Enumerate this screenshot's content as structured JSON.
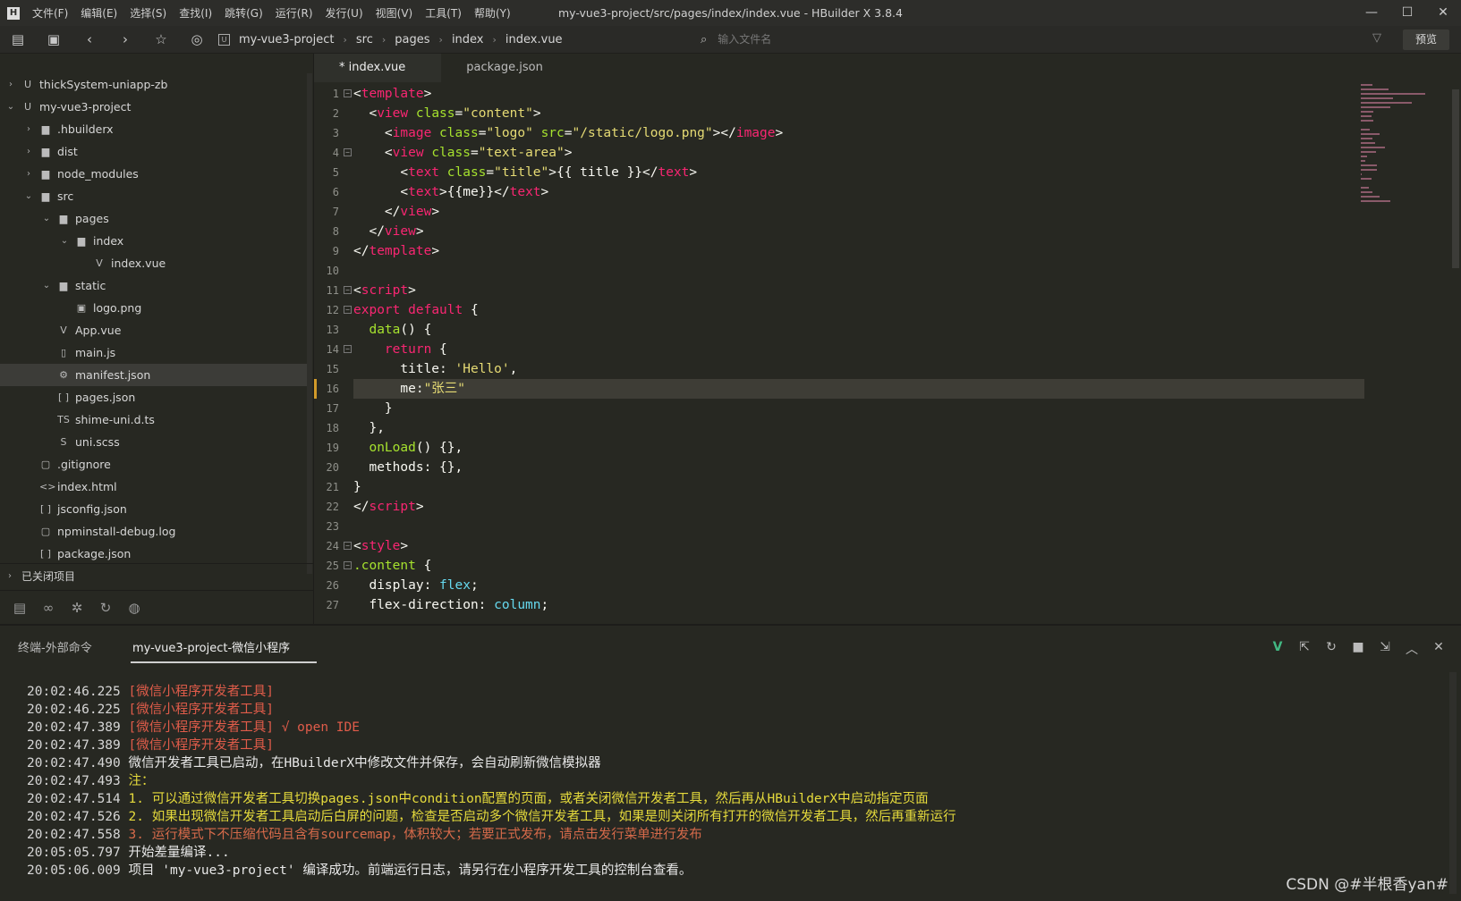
{
  "app": {
    "logo": "H",
    "title": "my-vue3-project/src/pages/index/index.vue - HBuilder X 3.8.4",
    "menu": [
      "文件(F)",
      "编辑(E)",
      "选择(S)",
      "查找(I)",
      "跳转(G)",
      "运行(R)",
      "发行(U)",
      "视图(V)",
      "工具(T)",
      "帮助(Y)"
    ],
    "window_buttons": {
      "minimize": "—",
      "maximize": "☐",
      "close": "✕"
    }
  },
  "toolbar": {
    "project_badge": "U",
    "breadcrumb": [
      "my-vue3-project",
      "src",
      "pages",
      "index",
      "index.vue"
    ],
    "search_placeholder": "输入文件名",
    "preview_label": "预览"
  },
  "sidebar": {
    "tree": [
      {
        "label": "thickSystem-uniapp-zb",
        "depth": 0,
        "arrow": "›",
        "icon": "U"
      },
      {
        "label": "my-vue3-project",
        "depth": 0,
        "arrow": "⌄",
        "icon": "U"
      },
      {
        "label": ".hbuilderx",
        "depth": 1,
        "arrow": "›",
        "icon": "▆"
      },
      {
        "label": "dist",
        "depth": 1,
        "arrow": "›",
        "icon": "▆"
      },
      {
        "label": "node_modules",
        "depth": 1,
        "arrow": "›",
        "icon": "▆"
      },
      {
        "label": "src",
        "depth": 1,
        "arrow": "⌄",
        "icon": "▆"
      },
      {
        "label": "pages",
        "depth": 2,
        "arrow": "⌄",
        "icon": "▆"
      },
      {
        "label": "index",
        "depth": 3,
        "arrow": "⌄",
        "icon": "▆"
      },
      {
        "label": "index.vue",
        "depth": 4,
        "arrow": "",
        "icon": "V"
      },
      {
        "label": "static",
        "depth": 2,
        "arrow": "⌄",
        "icon": "▆"
      },
      {
        "label": "logo.png",
        "depth": 3,
        "arrow": "",
        "icon": "▣"
      },
      {
        "label": "App.vue",
        "depth": 2,
        "arrow": "",
        "icon": "V"
      },
      {
        "label": "main.js",
        "depth": 2,
        "arrow": "",
        "icon": "▯"
      },
      {
        "label": "manifest.json",
        "depth": 2,
        "arrow": "",
        "icon": "⚙",
        "selected": true
      },
      {
        "label": "pages.json",
        "depth": 2,
        "arrow": "",
        "icon": "[ ]"
      },
      {
        "label": "shime-uni.d.ts",
        "depth": 2,
        "arrow": "",
        "icon": "TS"
      },
      {
        "label": "uni.scss",
        "depth": 2,
        "arrow": "",
        "icon": "S"
      },
      {
        "label": ".gitignore",
        "depth": 1,
        "arrow": "",
        "icon": "▢"
      },
      {
        "label": "index.html",
        "depth": 1,
        "arrow": "",
        "icon": "<>"
      },
      {
        "label": "jsconfig.json",
        "depth": 1,
        "arrow": "",
        "icon": "[ ]"
      },
      {
        "label": "npminstall-debug.log",
        "depth": 1,
        "arrow": "",
        "icon": "▢"
      },
      {
        "label": "package.json",
        "depth": 1,
        "arrow": "",
        "icon": "[ ]"
      }
    ],
    "closed_projects": "已关闭项目"
  },
  "editor": {
    "tabs": [
      {
        "label": "* index.vue",
        "active": true
      },
      {
        "label": "package.json",
        "active": false
      }
    ],
    "current_line": 16,
    "lines": [
      {
        "n": "1",
        "fold": true,
        "tokens": [
          [
            "t-pun",
            "<"
          ],
          [
            "t-tag",
            "template"
          ],
          [
            "t-pun",
            ">"
          ]
        ]
      },
      {
        "n": "2",
        "fold": false,
        "tokens": [
          [
            "t-plain",
            "  <"
          ],
          [
            "t-tag",
            "view"
          ],
          [
            "t-plain",
            " "
          ],
          [
            "t-attr",
            "class"
          ],
          [
            "t-pun",
            "="
          ],
          [
            "t-str",
            "\"content\""
          ],
          [
            "t-pun",
            ">"
          ]
        ]
      },
      {
        "n": "3",
        "fold": false,
        "tokens": [
          [
            "t-plain",
            "    <"
          ],
          [
            "t-tag",
            "image"
          ],
          [
            "t-plain",
            " "
          ],
          [
            "t-attr",
            "class"
          ],
          [
            "t-pun",
            "="
          ],
          [
            "t-str",
            "\"logo\""
          ],
          [
            "t-plain",
            " "
          ],
          [
            "t-attr",
            "src"
          ],
          [
            "t-pun",
            "="
          ],
          [
            "t-str",
            "\"/static/logo.png\""
          ],
          [
            "t-pun",
            "></"
          ],
          [
            "t-tag",
            "image"
          ],
          [
            "t-pun",
            ">"
          ]
        ]
      },
      {
        "n": "4",
        "fold": true,
        "tokens": [
          [
            "t-plain",
            "    <"
          ],
          [
            "t-tag",
            "view"
          ],
          [
            "t-plain",
            " "
          ],
          [
            "t-attr",
            "class"
          ],
          [
            "t-pun",
            "="
          ],
          [
            "t-str",
            "\"text-area\""
          ],
          [
            "t-pun",
            ">"
          ]
        ]
      },
      {
        "n": "5",
        "fold": false,
        "tokens": [
          [
            "t-plain",
            "      <"
          ],
          [
            "t-tag",
            "text"
          ],
          [
            "t-plain",
            " "
          ],
          [
            "t-attr",
            "class"
          ],
          [
            "t-pun",
            "="
          ],
          [
            "t-str",
            "\"title\""
          ],
          [
            "t-pun",
            ">{{ title }}</"
          ],
          [
            "t-tag",
            "text"
          ],
          [
            "t-pun",
            ">"
          ]
        ]
      },
      {
        "n": "6",
        "fold": false,
        "tokens": [
          [
            "t-plain",
            "      <"
          ],
          [
            "t-tag",
            "text"
          ],
          [
            "t-pun",
            ">{{me}}</"
          ],
          [
            "t-tag",
            "text"
          ],
          [
            "t-pun",
            ">"
          ]
        ]
      },
      {
        "n": "7",
        "fold": false,
        "tokens": [
          [
            "t-plain",
            "    </"
          ],
          [
            "t-tag",
            "view"
          ],
          [
            "t-pun",
            ">"
          ]
        ]
      },
      {
        "n": "8",
        "fold": false,
        "tokens": [
          [
            "t-plain",
            "  </"
          ],
          [
            "t-tag",
            "view"
          ],
          [
            "t-pun",
            ">"
          ]
        ]
      },
      {
        "n": "9",
        "fold": false,
        "tokens": [
          [
            "t-pun",
            "</"
          ],
          [
            "t-tag",
            "template"
          ],
          [
            "t-pun",
            ">"
          ]
        ]
      },
      {
        "n": "10",
        "fold": false,
        "tokens": []
      },
      {
        "n": "11",
        "fold": true,
        "tokens": [
          [
            "t-pun",
            "<"
          ],
          [
            "t-tag",
            "script"
          ],
          [
            "t-pun",
            ">"
          ]
        ]
      },
      {
        "n": "12",
        "fold": true,
        "tokens": [
          [
            "t-kw",
            "export"
          ],
          [
            "t-plain",
            " "
          ],
          [
            "t-kw",
            "default"
          ],
          [
            "t-plain",
            " {"
          ]
        ]
      },
      {
        "n": "13",
        "fold": false,
        "tokens": [
          [
            "t-plain",
            "  "
          ],
          [
            "t-fn",
            "data"
          ],
          [
            "t-plain",
            "() {"
          ]
        ]
      },
      {
        "n": "14",
        "fold": true,
        "tokens": [
          [
            "t-plain",
            "    "
          ],
          [
            "t-kw",
            "return"
          ],
          [
            "t-plain",
            " {"
          ]
        ]
      },
      {
        "n": "15",
        "fold": false,
        "tokens": [
          [
            "t-plain",
            "      title: "
          ],
          [
            "t-str",
            "'Hello'"
          ],
          [
            "t-plain",
            ","
          ]
        ]
      },
      {
        "n": "16",
        "fold": false,
        "tokens": [
          [
            "t-plain",
            "      me:"
          ],
          [
            "t-str",
            "\"张三\""
          ]
        ]
      },
      {
        "n": "17",
        "fold": false,
        "tokens": [
          [
            "t-plain",
            "    }"
          ]
        ]
      },
      {
        "n": "18",
        "fold": false,
        "tokens": [
          [
            "t-plain",
            "  },"
          ]
        ]
      },
      {
        "n": "19",
        "fold": false,
        "tokens": [
          [
            "t-plain",
            "  "
          ],
          [
            "t-fn",
            "onLoad"
          ],
          [
            "t-plain",
            "() {},"
          ]
        ]
      },
      {
        "n": "20",
        "fold": false,
        "tokens": [
          [
            "t-plain",
            "  methods: {},"
          ]
        ]
      },
      {
        "n": "21",
        "fold": false,
        "tokens": [
          [
            "t-plain",
            "}"
          ]
        ]
      },
      {
        "n": "22",
        "fold": false,
        "tokens": [
          [
            "t-pun",
            "</"
          ],
          [
            "t-tag",
            "script"
          ],
          [
            "t-pun",
            ">"
          ]
        ]
      },
      {
        "n": "23",
        "fold": false,
        "tokens": []
      },
      {
        "n": "24",
        "fold": true,
        "tokens": [
          [
            "t-pun",
            "<"
          ],
          [
            "t-tag",
            "style"
          ],
          [
            "t-pun",
            ">"
          ]
        ]
      },
      {
        "n": "25",
        "fold": true,
        "tokens": [
          [
            "t-cls",
            ".content"
          ],
          [
            "t-plain",
            " {"
          ]
        ]
      },
      {
        "n": "26",
        "fold": false,
        "tokens": [
          [
            "t-plain",
            "  display: "
          ],
          [
            "t-prop",
            "flex"
          ],
          [
            "t-plain",
            ";"
          ]
        ]
      },
      {
        "n": "27",
        "fold": false,
        "tokens": [
          [
            "t-plain",
            "  flex-direction: "
          ],
          [
            "t-prop",
            "column"
          ],
          [
            "t-plain",
            ";"
          ]
        ]
      }
    ]
  },
  "panel": {
    "tabs": [
      {
        "label": "终端-外部命令",
        "active": false
      },
      {
        "label": "my-vue3-project-微信小程序",
        "active": true
      }
    ],
    "icons": [
      "V",
      "⇱",
      "↻",
      "■",
      "⇲",
      "︿",
      "✕"
    ],
    "log": [
      {
        "ts": "20:02:46.225",
        "cls": "c-red",
        "text": "[微信小程序开发者工具]"
      },
      {
        "ts": "20:02:46.225",
        "cls": "c-red",
        "text": "[微信小程序开发者工具]"
      },
      {
        "ts": "20:02:47.389",
        "cls": "c-red",
        "text": "[微信小程序开发者工具] √ open IDE"
      },
      {
        "ts": "20:02:47.389",
        "cls": "c-red",
        "text": "[微信小程序开发者工具]"
      },
      {
        "ts": "20:02:47.490",
        "cls": "c-white",
        "text": "微信开发者工具已启动，在HBuilderX中修改文件并保存，会自动刷新微信模拟器"
      },
      {
        "ts": "20:02:47.493",
        "cls": "c-yellow",
        "text": "注："
      },
      {
        "ts": "20:02:47.514",
        "cls": "c-yellow",
        "text": "1. 可以通过微信开发者工具切换pages.json中condition配置的页面，或者关闭微信开发者工具，然后再从HBuilderX中启动指定页面"
      },
      {
        "ts": "20:02:47.526",
        "cls": "c-yellow",
        "text": "2. 如果出现微信开发者工具启动后白屏的问题，检查是否启动多个微信开发者工具，如果是则关闭所有打开的微信开发者工具，然后再重新运行"
      },
      {
        "ts": "20:02:47.558",
        "cls": "c-orange",
        "text": "3. 运行模式下不压缩代码且含有sourcemap，体积较大；若要正式发布，请点击发行菜单进行发布"
      },
      {
        "ts": "20:05:05.797",
        "cls": "c-white",
        "text": "开始差量编译..."
      },
      {
        "ts": "20:05:06.009",
        "cls": "c-white",
        "text": "项目 'my-vue3-project' 编译成功。前端运行日志，请另行在小程序开发工具的控制台查看。"
      }
    ]
  },
  "watermark": "CSDN @#半根香yan#"
}
